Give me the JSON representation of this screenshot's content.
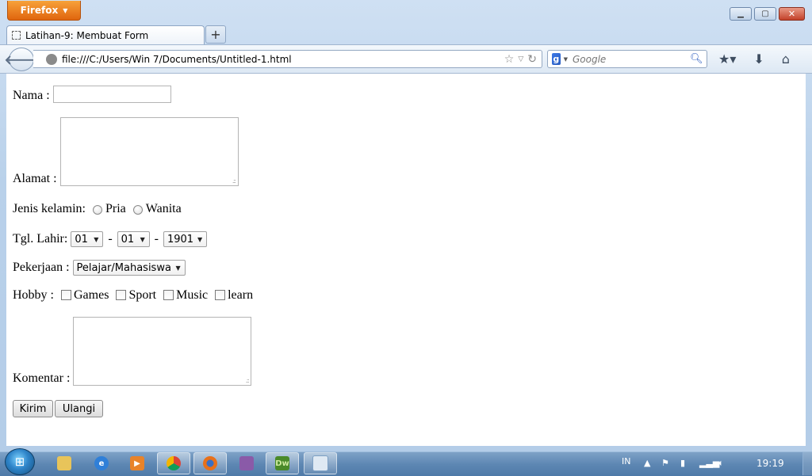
{
  "window": {
    "firefox_button": "Firefox",
    "tab_title": "Latihan-9: Membuat Form",
    "new_tab": "+"
  },
  "navbar": {
    "url": "file:///C:/Users/Win 7/Documents/Untitled-1.html",
    "search_placeholder": "Google",
    "search_engine_letter": "g"
  },
  "form": {
    "nama_label": "Nama :",
    "nama_value": "",
    "alamat_label": "Alamat :",
    "alamat_value": "",
    "gender_label": "Jenis kelamin:",
    "gender_options": [
      "Pria",
      "Wanita"
    ],
    "dob_label": "Tgl. Lahir:",
    "dob_day": "01",
    "dob_month": "01",
    "dob_year": "1901",
    "dob_separator": "-",
    "job_label": "Pekerjaan :",
    "job_value": "Pelajar/Mahasiswa",
    "hobby_label": "Hobby :",
    "hobby_options": [
      "Games",
      "Sport",
      "Music",
      "learn"
    ],
    "komentar_label": "Komentar :",
    "komentar_value": "",
    "submit_label": "Kirim",
    "reset_label": "Ulangi"
  },
  "taskbar": {
    "apps": [
      "explorer",
      "internet-explorer",
      "media-player",
      "chrome",
      "firefox",
      "winrar",
      "dreamweaver",
      "notepad"
    ],
    "dreamweaver_text": "Dw",
    "language": "IN",
    "clock": "19:19"
  }
}
